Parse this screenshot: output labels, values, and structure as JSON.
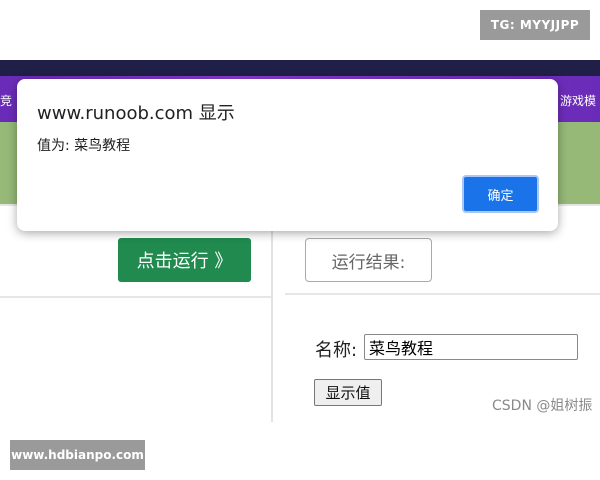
{
  "watermark_top": "TG: MYYJJPP",
  "watermark_bottom": "www.hdbianpo.com",
  "background": {
    "banner_left_text": "竞",
    "banner_right_text": "游戏模",
    "run_button_label": "点击运行 》",
    "result_button_label": "运行结果:",
    "name_label": "名称:",
    "name_input_value": "菜鸟教程",
    "show_button_label": "显示值",
    "csdn_credit": "CSDN @姐树振"
  },
  "dialog": {
    "title": "www.runoob.com 显示",
    "message": "值为: 菜鸟教程",
    "ok_label": "确定",
    "ok_color": "#1a73e8"
  }
}
